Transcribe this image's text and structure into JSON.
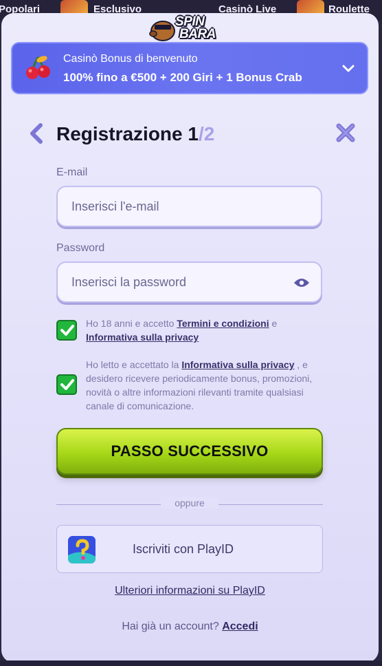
{
  "nav": {
    "items": [
      "Popolari",
      "Esclusivo",
      "Casinò Live",
      "Roulette"
    ]
  },
  "logo": {
    "line1": "SPIN",
    "line2": "BARA"
  },
  "bonus": {
    "title": "Casinò Bonus di benvenuto",
    "offer": "100% fino a €500 + 200 Giri + 1 Bonus Crab"
  },
  "header": {
    "title": "Registrazione 1",
    "step_separator": "/",
    "step_total": "2"
  },
  "email": {
    "label": "E-mail",
    "placeholder": "Inserisci l'e-mail"
  },
  "password": {
    "label": "Password",
    "placeholder": "Inserisci la password"
  },
  "consent1": {
    "prefix": "Ho 18 anni e accetto ",
    "terms_link": "Termini e condizioni",
    "middle": " e ",
    "privacy_link": "Informativa sulla privacy",
    "checked": true
  },
  "consent2": {
    "prefix": "Ho letto e accettato la ",
    "privacy_link": "Informativa sulla privacy",
    "suffix": " , e desidero ricevere periodicamente bonus, promozioni, novità o altre informazioni rilevanti tramite qualsiasi canale di comunicazione.",
    "checked": true
  },
  "cta": {
    "label": "PASSO SUCCESSIVO"
  },
  "divider": {
    "label": "oppure"
  },
  "playid": {
    "label": "Iscriviti con PlayID",
    "more_link": "Ulteriori informazioni su PlayID"
  },
  "login": {
    "prompt": "Hai già un account? ",
    "link": "Accedi"
  },
  "colors": {
    "accent": "#5a63ea",
    "cta": "#a6d818",
    "check": "#21b63c"
  }
}
